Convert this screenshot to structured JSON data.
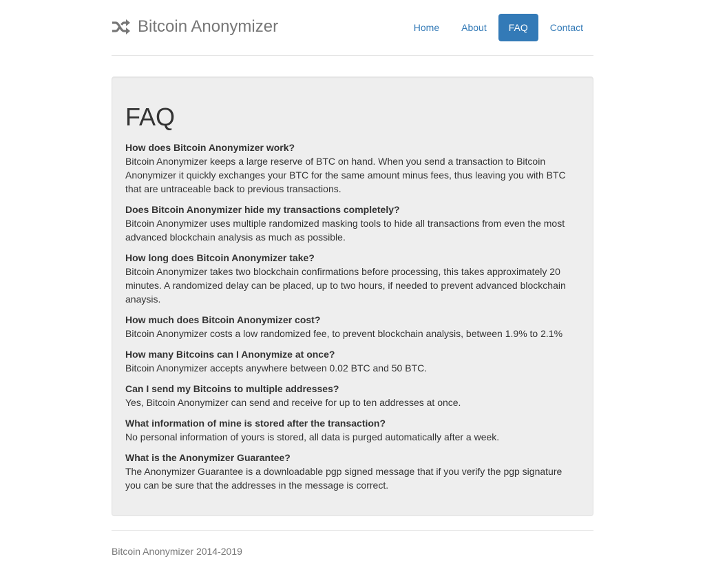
{
  "brand": {
    "title": "Bitcoin Anonymizer",
    "icon": "shuffle-icon"
  },
  "nav": {
    "items": [
      {
        "label": "Home",
        "active": false
      },
      {
        "label": "About",
        "active": false
      },
      {
        "label": "FAQ",
        "active": true
      },
      {
        "label": "Contact",
        "active": false
      }
    ]
  },
  "main": {
    "title": "FAQ",
    "faqs": [
      {
        "question": "How does Bitcoin Anonymizer work?",
        "answer": "Bitcoin Anonymizer keeps a large reserve of BTC on hand. When you send a transaction to Bitcoin Anonymizer it quickly exchanges your BTC for the same amount minus fees, thus leaving you with BTC that are untraceable back to previous transactions."
      },
      {
        "question": "Does Bitcoin Anonymizer hide my transactions completely?",
        "answer": "Bitcoin Anonymizer uses multiple randomized masking tools to hide all transactions from even the most advanced blockchain analysis as much as possible."
      },
      {
        "question": "How long does Bitcoin Anonymizer take?",
        "answer": "Bitcoin Anonymizer takes two blockchain confirmations before processing, this takes approximately 20 minutes. A randomized delay can be placed, up to two hours, if needed to prevent advanced blockchain anaysis."
      },
      {
        "question": "How much does Bitcoin Anonymizer cost?",
        "answer": "Bitcoin Anonymizer costs a low randomized fee, to prevent blockchain analysis, between 1.9% to 2.1%"
      },
      {
        "question": "How many Bitcoins can I Anonymize at once?",
        "answer": "Bitcoin Anonymizer accepts anywhere between 0.02 BTC and 50 BTC."
      },
      {
        "question": "Can I send my Bitcoins to multiple addresses?",
        "answer": "Yes, Bitcoin Anonymizer can send and receive for up to ten addresses at once."
      },
      {
        "question": "What information of mine is stored after the transaction?",
        "answer": "No personal information of yours is stored, all data is purged automatically after a week."
      },
      {
        "question": "What is the Anonymizer Guarantee?",
        "answer": "The Anonymizer Guarantee is a downloadable pgp signed message that if you verify the pgp signature you can be sure that the addresses in the message is correct."
      }
    ]
  },
  "footer": {
    "text": "Bitcoin Anonymizer 2014-2019"
  },
  "colors": {
    "accent": "#337ab7",
    "muted": "#777777",
    "panel": "#eeeeee"
  }
}
